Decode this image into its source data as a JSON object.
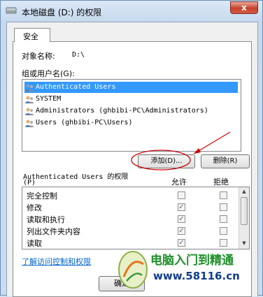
{
  "window": {
    "title": "本地磁盘 (D:) 的权限",
    "close_label": "x"
  },
  "tabs": [
    {
      "label": "安全"
    }
  ],
  "object": {
    "label": "对象名称:",
    "value": "D:\\"
  },
  "groups": {
    "label": "组或用户名(G):",
    "items": [
      {
        "label": "Authenticated Users",
        "selected": true
      },
      {
        "label": "SYSTEM",
        "selected": false
      },
      {
        "label": "Administrators (ghbibi-PC\\Administrators)",
        "selected": false
      },
      {
        "label": "Users (ghbibi-PC\\Users)",
        "selected": false
      }
    ]
  },
  "buttons": {
    "add": "添加(D)...",
    "remove": "删除(R)",
    "ok": "确定"
  },
  "permissions": {
    "title_line1": "Authenticated Users 的权限",
    "title_line2": "(P)",
    "allow_header": "允许",
    "deny_header": "拒绝",
    "rows": [
      {
        "name": "完全控制",
        "allow": false,
        "deny": false
      },
      {
        "name": "修改",
        "allow": true,
        "deny": false
      },
      {
        "name": "读取和执行",
        "allow": true,
        "deny": false
      },
      {
        "name": "列出文件夹内容",
        "allow": true,
        "deny": false
      },
      {
        "name": "读取",
        "allow": true,
        "deny": false
      }
    ]
  },
  "link": "了解访问控制和权限",
  "watermark": {
    "line1": "电脑入门到精通",
    "line2": "www.58116.cn"
  },
  "colors": {
    "selection": "#3399ff",
    "annotation": "#cc0000",
    "link": "#0066cc"
  }
}
